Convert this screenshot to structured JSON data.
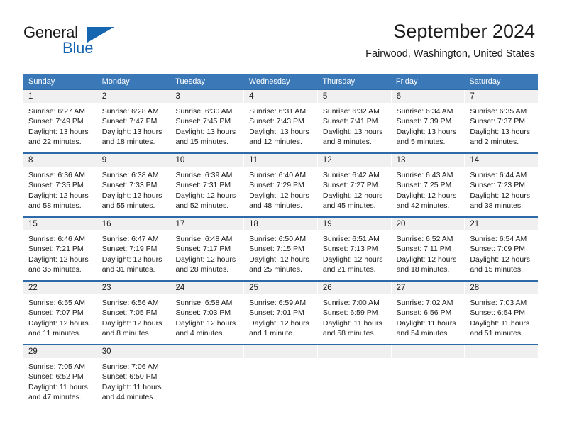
{
  "brand": {
    "name_part1": "General",
    "name_part2": "Blue",
    "logo_icon": "triangle-icon"
  },
  "header": {
    "title": "September 2024",
    "subtitle": "Fairwood, Washington, United States"
  },
  "colors": {
    "header_blue": "#3b78b8",
    "row_divider_blue": "#2f6aa8",
    "day_band_gray": "#f0f0f0",
    "brand_blue": "#1565b0",
    "text": "#1a1a1a"
  },
  "weekdays": [
    "Sunday",
    "Monday",
    "Tuesday",
    "Wednesday",
    "Thursday",
    "Friday",
    "Saturday"
  ],
  "weeks": [
    [
      {
        "day": "1",
        "sunrise": "Sunrise: 6:27 AM",
        "sunset": "Sunset: 7:49 PM",
        "daylight_1": "Daylight: 13 hours",
        "daylight_2": "and 22 minutes."
      },
      {
        "day": "2",
        "sunrise": "Sunrise: 6:28 AM",
        "sunset": "Sunset: 7:47 PM",
        "daylight_1": "Daylight: 13 hours",
        "daylight_2": "and 18 minutes."
      },
      {
        "day": "3",
        "sunrise": "Sunrise: 6:30 AM",
        "sunset": "Sunset: 7:45 PM",
        "daylight_1": "Daylight: 13 hours",
        "daylight_2": "and 15 minutes."
      },
      {
        "day": "4",
        "sunrise": "Sunrise: 6:31 AM",
        "sunset": "Sunset: 7:43 PM",
        "daylight_1": "Daylight: 13 hours",
        "daylight_2": "and 12 minutes."
      },
      {
        "day": "5",
        "sunrise": "Sunrise: 6:32 AM",
        "sunset": "Sunset: 7:41 PM",
        "daylight_1": "Daylight: 13 hours",
        "daylight_2": "and 8 minutes."
      },
      {
        "day": "6",
        "sunrise": "Sunrise: 6:34 AM",
        "sunset": "Sunset: 7:39 PM",
        "daylight_1": "Daylight: 13 hours",
        "daylight_2": "and 5 minutes."
      },
      {
        "day": "7",
        "sunrise": "Sunrise: 6:35 AM",
        "sunset": "Sunset: 7:37 PM",
        "daylight_1": "Daylight: 13 hours",
        "daylight_2": "and 2 minutes."
      }
    ],
    [
      {
        "day": "8",
        "sunrise": "Sunrise: 6:36 AM",
        "sunset": "Sunset: 7:35 PM",
        "daylight_1": "Daylight: 12 hours",
        "daylight_2": "and 58 minutes."
      },
      {
        "day": "9",
        "sunrise": "Sunrise: 6:38 AM",
        "sunset": "Sunset: 7:33 PM",
        "daylight_1": "Daylight: 12 hours",
        "daylight_2": "and 55 minutes."
      },
      {
        "day": "10",
        "sunrise": "Sunrise: 6:39 AM",
        "sunset": "Sunset: 7:31 PM",
        "daylight_1": "Daylight: 12 hours",
        "daylight_2": "and 52 minutes."
      },
      {
        "day": "11",
        "sunrise": "Sunrise: 6:40 AM",
        "sunset": "Sunset: 7:29 PM",
        "daylight_1": "Daylight: 12 hours",
        "daylight_2": "and 48 minutes."
      },
      {
        "day": "12",
        "sunrise": "Sunrise: 6:42 AM",
        "sunset": "Sunset: 7:27 PM",
        "daylight_1": "Daylight: 12 hours",
        "daylight_2": "and 45 minutes."
      },
      {
        "day": "13",
        "sunrise": "Sunrise: 6:43 AM",
        "sunset": "Sunset: 7:25 PM",
        "daylight_1": "Daylight: 12 hours",
        "daylight_2": "and 42 minutes."
      },
      {
        "day": "14",
        "sunrise": "Sunrise: 6:44 AM",
        "sunset": "Sunset: 7:23 PM",
        "daylight_1": "Daylight: 12 hours",
        "daylight_2": "and 38 minutes."
      }
    ],
    [
      {
        "day": "15",
        "sunrise": "Sunrise: 6:46 AM",
        "sunset": "Sunset: 7:21 PM",
        "daylight_1": "Daylight: 12 hours",
        "daylight_2": "and 35 minutes."
      },
      {
        "day": "16",
        "sunrise": "Sunrise: 6:47 AM",
        "sunset": "Sunset: 7:19 PM",
        "daylight_1": "Daylight: 12 hours",
        "daylight_2": "and 31 minutes."
      },
      {
        "day": "17",
        "sunrise": "Sunrise: 6:48 AM",
        "sunset": "Sunset: 7:17 PM",
        "daylight_1": "Daylight: 12 hours",
        "daylight_2": "and 28 minutes."
      },
      {
        "day": "18",
        "sunrise": "Sunrise: 6:50 AM",
        "sunset": "Sunset: 7:15 PM",
        "daylight_1": "Daylight: 12 hours",
        "daylight_2": "and 25 minutes."
      },
      {
        "day": "19",
        "sunrise": "Sunrise: 6:51 AM",
        "sunset": "Sunset: 7:13 PM",
        "daylight_1": "Daylight: 12 hours",
        "daylight_2": "and 21 minutes."
      },
      {
        "day": "20",
        "sunrise": "Sunrise: 6:52 AM",
        "sunset": "Sunset: 7:11 PM",
        "daylight_1": "Daylight: 12 hours",
        "daylight_2": "and 18 minutes."
      },
      {
        "day": "21",
        "sunrise": "Sunrise: 6:54 AM",
        "sunset": "Sunset: 7:09 PM",
        "daylight_1": "Daylight: 12 hours",
        "daylight_2": "and 15 minutes."
      }
    ],
    [
      {
        "day": "22",
        "sunrise": "Sunrise: 6:55 AM",
        "sunset": "Sunset: 7:07 PM",
        "daylight_1": "Daylight: 12 hours",
        "daylight_2": "and 11 minutes."
      },
      {
        "day": "23",
        "sunrise": "Sunrise: 6:56 AM",
        "sunset": "Sunset: 7:05 PM",
        "daylight_1": "Daylight: 12 hours",
        "daylight_2": "and 8 minutes."
      },
      {
        "day": "24",
        "sunrise": "Sunrise: 6:58 AM",
        "sunset": "Sunset: 7:03 PM",
        "daylight_1": "Daylight: 12 hours",
        "daylight_2": "and 4 minutes."
      },
      {
        "day": "25",
        "sunrise": "Sunrise: 6:59 AM",
        "sunset": "Sunset: 7:01 PM",
        "daylight_1": "Daylight: 12 hours",
        "daylight_2": "and 1 minute."
      },
      {
        "day": "26",
        "sunrise": "Sunrise: 7:00 AM",
        "sunset": "Sunset: 6:59 PM",
        "daylight_1": "Daylight: 11 hours",
        "daylight_2": "and 58 minutes."
      },
      {
        "day": "27",
        "sunrise": "Sunrise: 7:02 AM",
        "sunset": "Sunset: 6:56 PM",
        "daylight_1": "Daylight: 11 hours",
        "daylight_2": "and 54 minutes."
      },
      {
        "day": "28",
        "sunrise": "Sunrise: 7:03 AM",
        "sunset": "Sunset: 6:54 PM",
        "daylight_1": "Daylight: 11 hours",
        "daylight_2": "and 51 minutes."
      }
    ],
    [
      {
        "day": "29",
        "sunrise": "Sunrise: 7:05 AM",
        "sunset": "Sunset: 6:52 PM",
        "daylight_1": "Daylight: 11 hours",
        "daylight_2": "and 47 minutes."
      },
      {
        "day": "30",
        "sunrise": "Sunrise: 7:06 AM",
        "sunset": "Sunset: 6:50 PM",
        "daylight_1": "Daylight: 11 hours",
        "daylight_2": "and 44 minutes."
      },
      {
        "day": "",
        "sunrise": "",
        "sunset": "",
        "daylight_1": "",
        "daylight_2": ""
      },
      {
        "day": "",
        "sunrise": "",
        "sunset": "",
        "daylight_1": "",
        "daylight_2": ""
      },
      {
        "day": "",
        "sunrise": "",
        "sunset": "",
        "daylight_1": "",
        "daylight_2": ""
      },
      {
        "day": "",
        "sunrise": "",
        "sunset": "",
        "daylight_1": "",
        "daylight_2": ""
      },
      {
        "day": "",
        "sunrise": "",
        "sunset": "",
        "daylight_1": "",
        "daylight_2": ""
      }
    ]
  ]
}
